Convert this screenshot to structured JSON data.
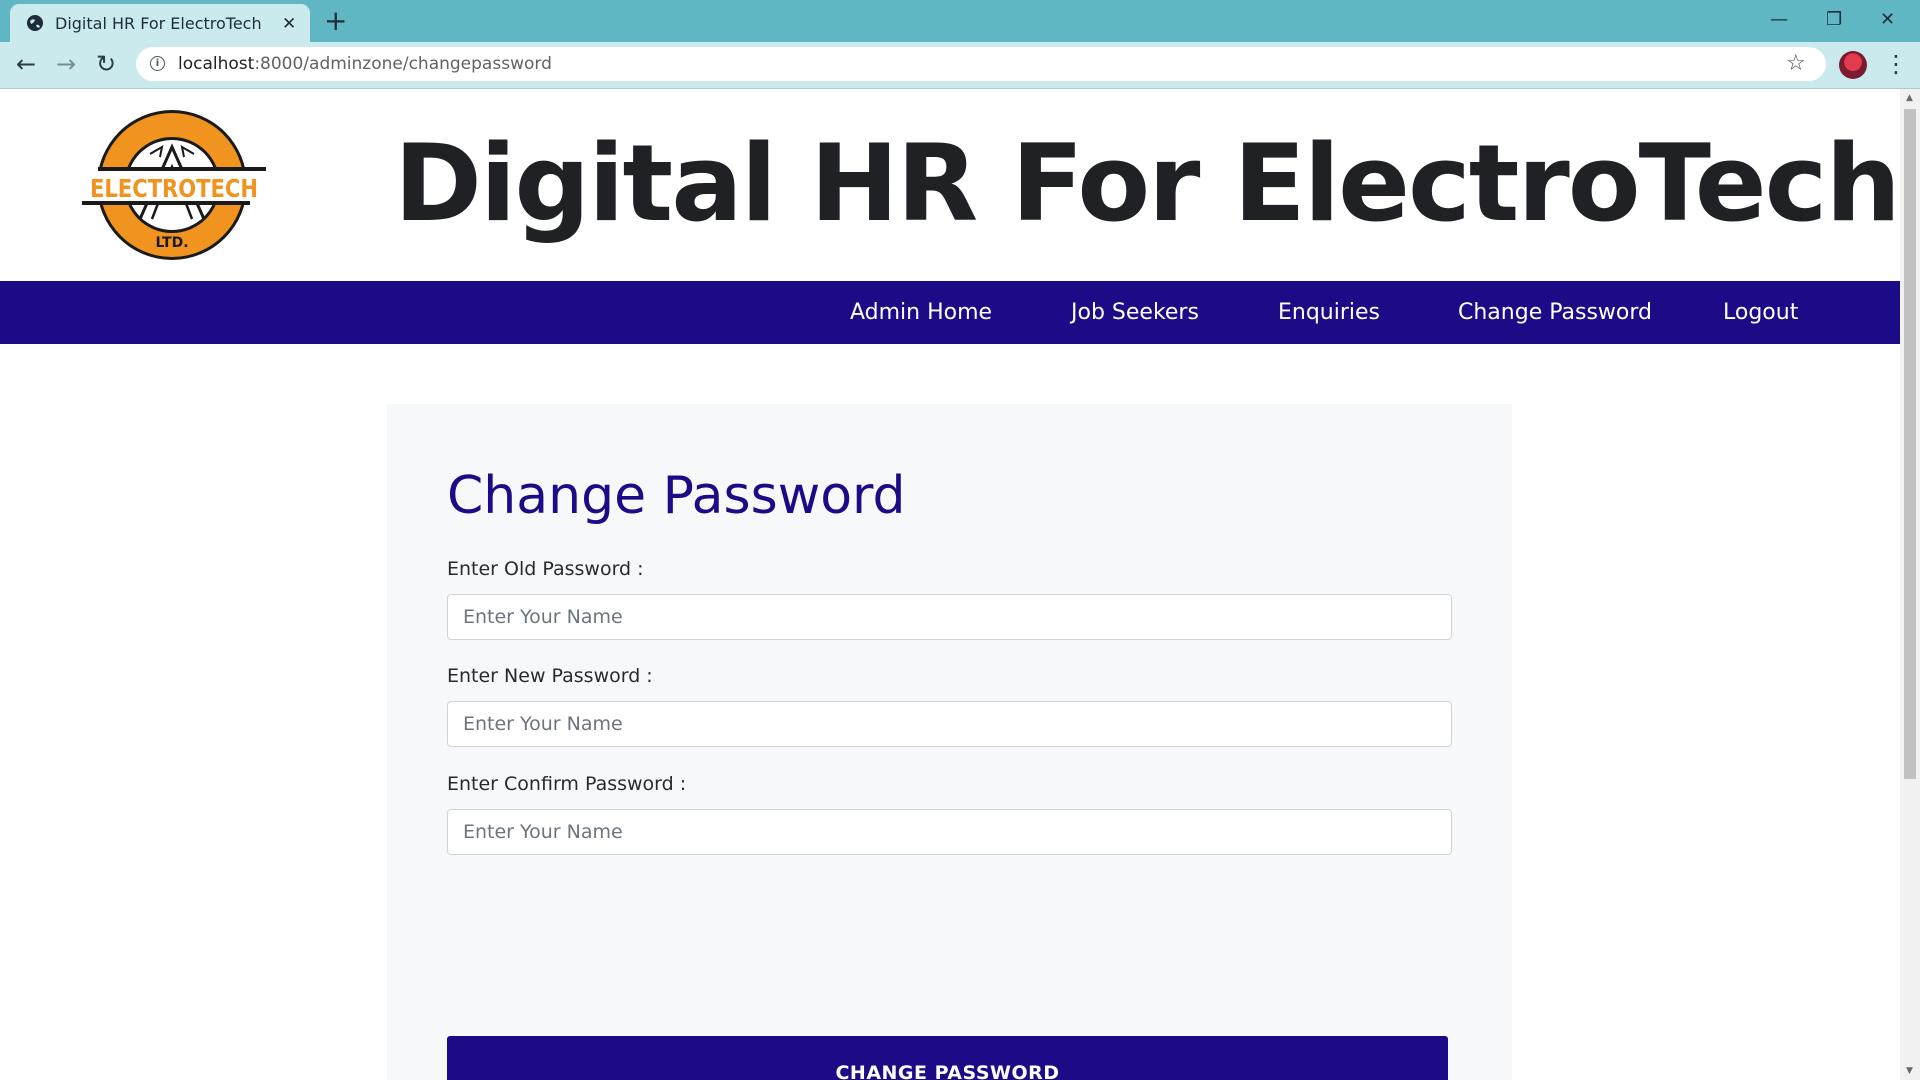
{
  "browser": {
    "tab_title": "Digital HR For ElectroTech",
    "url_host": "localhost",
    "url_path": ":8000/adminzone/changepassword"
  },
  "site": {
    "title": "Digital HR For ElectroTech",
    "logo": {
      "text": "ELECTROTECH",
      "subtext": "LTD.",
      "colors": {
        "ring": "#f1931f",
        "outline": "#1a1a1a"
      }
    }
  },
  "nav": {
    "items": [
      {
        "label": "Admin Home"
      },
      {
        "label": "Job Seekers"
      },
      {
        "label": "Enquiries"
      },
      {
        "label": "Change Password"
      },
      {
        "label": "Logout"
      }
    ]
  },
  "form": {
    "heading": "Change Password",
    "fields": [
      {
        "label": "Enter Old Password :",
        "placeholder": "Enter Your Name",
        "value": ""
      },
      {
        "label": "Enter New Password :",
        "placeholder": "Enter Your Name",
        "value": ""
      },
      {
        "label": "Enter Confirm Password :",
        "placeholder": "Enter Your Name",
        "value": ""
      }
    ],
    "submit_label": "CHANGE PASSWORD"
  },
  "colors": {
    "brand": "#1b0b86",
    "chrome_tabbar": "#5eb7c2",
    "chrome_toolbar": "#cbeaee",
    "panel_bg": "#f7f8f9"
  }
}
